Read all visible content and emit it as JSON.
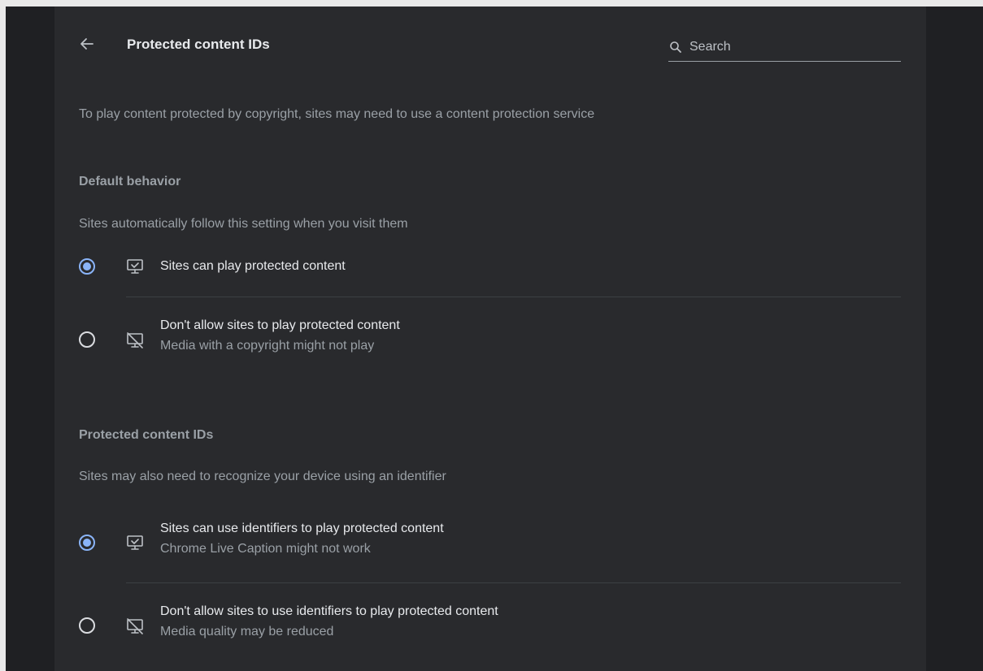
{
  "header": {
    "title": "Protected content IDs",
    "search_placeholder": "Search"
  },
  "description": "To play content protected by copyright, sites may need to use a content protection service",
  "default_behavior": {
    "title": "Default behavior",
    "subtitle": "Sites automatically follow this setting when you visit them",
    "options": [
      {
        "label": "Sites can play protected content",
        "sublabel": "",
        "checked": true,
        "icon": "monitor-check-icon"
      },
      {
        "label": "Don't allow sites to play protected content",
        "sublabel": "Media with a copyright might not play",
        "checked": false,
        "icon": "monitor-off-icon"
      }
    ]
  },
  "protected_ids": {
    "title": "Protected content IDs",
    "subtitle": "Sites may also need to recognize your device using an identifier",
    "options": [
      {
        "label": "Sites can use identifiers to play protected content",
        "sublabel": "Chrome Live Caption might not work",
        "checked": true,
        "icon": "monitor-check-icon"
      },
      {
        "label": "Don't allow sites to use identifiers to play protected content",
        "sublabel": "Media quality may be reduced",
        "checked": false,
        "icon": "monitor-off-icon"
      }
    ]
  },
  "colors": {
    "accent": "#8ab4f8",
    "card_bg": "#292a2d",
    "page_bg": "#1f2023"
  }
}
